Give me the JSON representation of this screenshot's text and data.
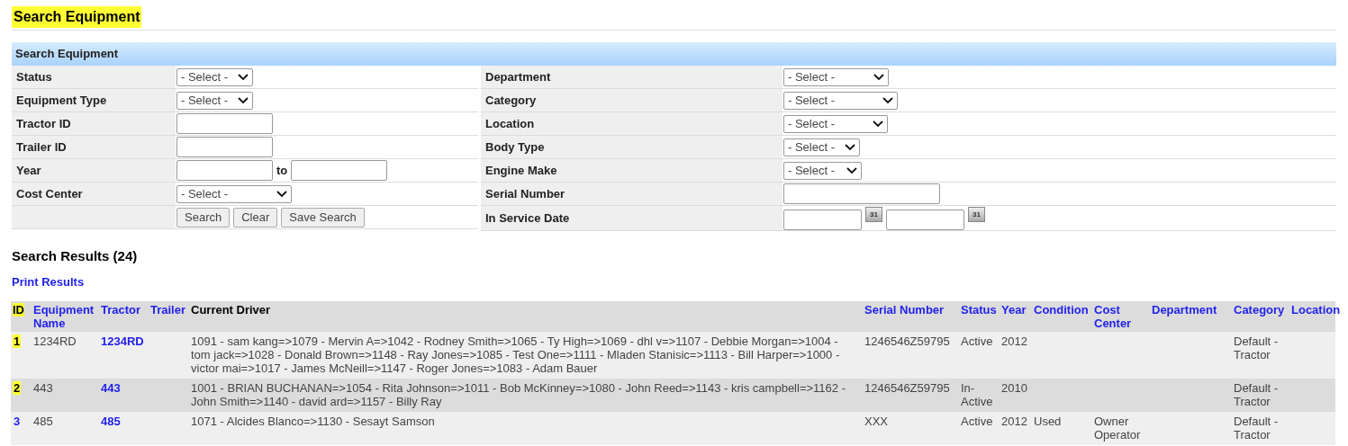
{
  "page_title": {
    "text": "Search Equipment",
    "highlighted": true
  },
  "search_panel": {
    "title": "Search Equipment",
    "left_fields": [
      {
        "label": "Status",
        "kind": "select",
        "value": "- Select -"
      },
      {
        "label": "Equipment Type",
        "kind": "select",
        "value": "- Select -"
      },
      {
        "label": "Tractor ID",
        "kind": "text"
      },
      {
        "label": "Trailer ID",
        "kind": "text"
      },
      {
        "label": "Year",
        "kind": "range",
        "separator": "to"
      },
      {
        "label": "Cost Center",
        "kind": "select",
        "value": "- Select -"
      },
      {
        "kind": "buttons",
        "buttons": [
          "Search",
          "Clear",
          "Save Search"
        ]
      }
    ],
    "right_fields": [
      {
        "label": "Department",
        "kind": "select",
        "value": "- Select -"
      },
      {
        "label": "Category",
        "kind": "select",
        "value": "- Select -"
      },
      {
        "label": "Location",
        "kind": "select",
        "value": "- Select -"
      },
      {
        "label": "Body Type",
        "kind": "select",
        "value": "- Select -"
      },
      {
        "label": "Engine Make",
        "kind": "select",
        "value": "- Select -"
      },
      {
        "label": "Serial Number",
        "kind": "text"
      },
      {
        "label": "In Service Date",
        "kind": "date_range",
        "calendar_labels": [
          "31",
          "31"
        ]
      }
    ]
  },
  "results": {
    "title": "Search Results (24)",
    "print_link": "Print Results",
    "columns": [
      {
        "label": "ID",
        "sortable": false,
        "highlighted": true
      },
      {
        "label": "Equipment Name",
        "sortable": true,
        "highlighted": false
      },
      {
        "label": "Tractor",
        "sortable": true,
        "highlighted": false
      },
      {
        "label": "Trailer",
        "sortable": true,
        "highlighted": false
      },
      {
        "label": "Current Driver",
        "sortable": false,
        "highlighted": false
      },
      {
        "label": "Serial Number",
        "sortable": true,
        "highlighted": false
      },
      {
        "label": "Status",
        "sortable": true,
        "highlighted": false
      },
      {
        "label": "Year",
        "sortable": true,
        "highlighted": false
      },
      {
        "label": "Condition",
        "sortable": true,
        "highlighted": false
      },
      {
        "label": "Cost Center",
        "sortable": true,
        "highlighted": false
      },
      {
        "label": "Department",
        "sortable": true,
        "highlighted": false
      },
      {
        "label": "Category",
        "sortable": true,
        "highlighted": false
      },
      {
        "label": "Location",
        "sortable": true,
        "highlighted": false
      }
    ],
    "rows": [
      {
        "id": "1",
        "highlighted": true,
        "equipment_name": "1234RD",
        "tractor": "1234RD",
        "current_driver": "1091 - sam kang=>1079 - Mervin A=>1042 - Rodney Smith=>1065 - Ty High=>1069 - dhl v=>1107 - Debbie Morgan=>1004 - tom jack=>1028 - Donald Brown=>1148 - Ray Jones=>1085 - Test One=>1111 - Mladen Stanisic=>1113 - Bill Harper=>1000 - victor mai=>1017 - James McNeill=>1147 - Roger Jones=>1083 - Adam Bauer",
        "serial_number": "1246546Z59795",
        "status": "Active",
        "year": "2012",
        "category": "Default - Tractor"
      },
      {
        "id": "2",
        "highlighted": true,
        "equipment_name": "443",
        "tractor": "443",
        "current_driver": "1001 - BRIAN BUCHANAN=>1054 - Rita Johnson=>1011 - Bob McKinney=>1080 - John Reed=>1143 - kris campbell=>1162 - John Smith=>1140 - david ard=>1157 - Billy Ray",
        "serial_number": "1246546Z59795",
        "status": "In-Active",
        "year": "2010",
        "category": "Default - Tractor"
      },
      {
        "id": "3",
        "highlighted": false,
        "equipment_name": "485",
        "tractor": "485",
        "current_driver": "1071 - Alcides Blanco=>1130 - Sesayt Samson",
        "serial_number": "XXX",
        "status": "Active",
        "year": "2012",
        "condition": "Used",
        "cost_center": "Owner Operator",
        "category": "Default - Tractor"
      }
    ]
  }
}
